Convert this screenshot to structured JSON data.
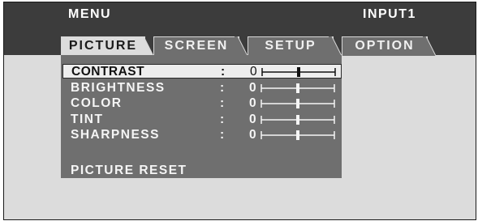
{
  "header": {
    "menu_label": "MENU",
    "input_label": "INPUT1"
  },
  "tabs": [
    {
      "label": "PICTURE",
      "active": true
    },
    {
      "label": "SCREEN",
      "active": false
    },
    {
      "label": "SETUP",
      "active": false
    },
    {
      "label": "OPTION",
      "active": false
    }
  ],
  "picture_menu": {
    "items": [
      {
        "label": "CONTRAST",
        "colon": ":",
        "value": "0",
        "selected": true
      },
      {
        "label": "BRIGHTNESS",
        "colon": ":",
        "value": "0",
        "selected": false
      },
      {
        "label": "COLOR",
        "colon": ":",
        "value": "0",
        "selected": false
      },
      {
        "label": "TINT",
        "colon": ":",
        "value": "0",
        "selected": false
      },
      {
        "label": "SHARPNESS",
        "colon": ":",
        "value": "0",
        "selected": false
      }
    ],
    "reset_label": "PICTURE RESET"
  },
  "colors": {
    "osd_background": "#dcdcdc",
    "topbar": "#3c3c3c",
    "panel": "#6f6f6f",
    "selected_row": "#eeeeee",
    "text_light": "#f5f5f5"
  }
}
